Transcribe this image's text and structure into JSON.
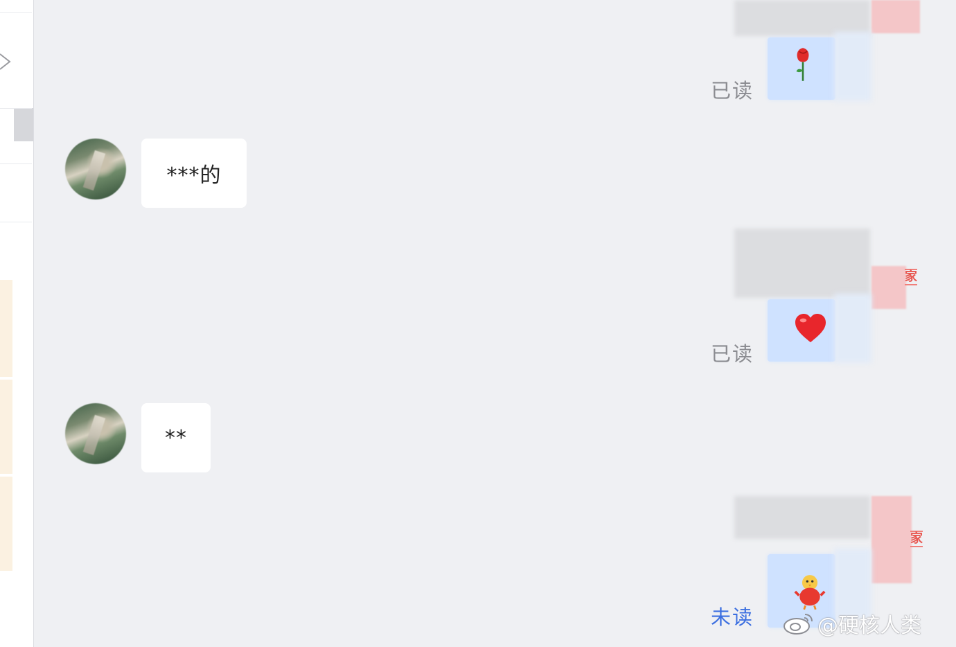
{
  "messages": {
    "incoming": [
      {
        "text": "***的"
      },
      {
        "text": "**"
      }
    ],
    "outgoing": [
      {
        "sticker": "rose-icon",
        "status": "已读",
        "tag": ""
      },
      {
        "sticker": "heart-icon",
        "status": "已读",
        "tag": "家"
      },
      {
        "sticker": "chick-sticker-icon",
        "status": "未读",
        "tag": "家"
      }
    ]
  },
  "watermark": {
    "text": "@硬核人类"
  },
  "colors": {
    "background": "#eff0f3",
    "outgoing_bubble": "#cfe2ff",
    "incoming_bubble": "#ffffff",
    "read_status": "#8a8b90",
    "unread_status": "#3c6fe0",
    "tag": "#e8564f"
  }
}
